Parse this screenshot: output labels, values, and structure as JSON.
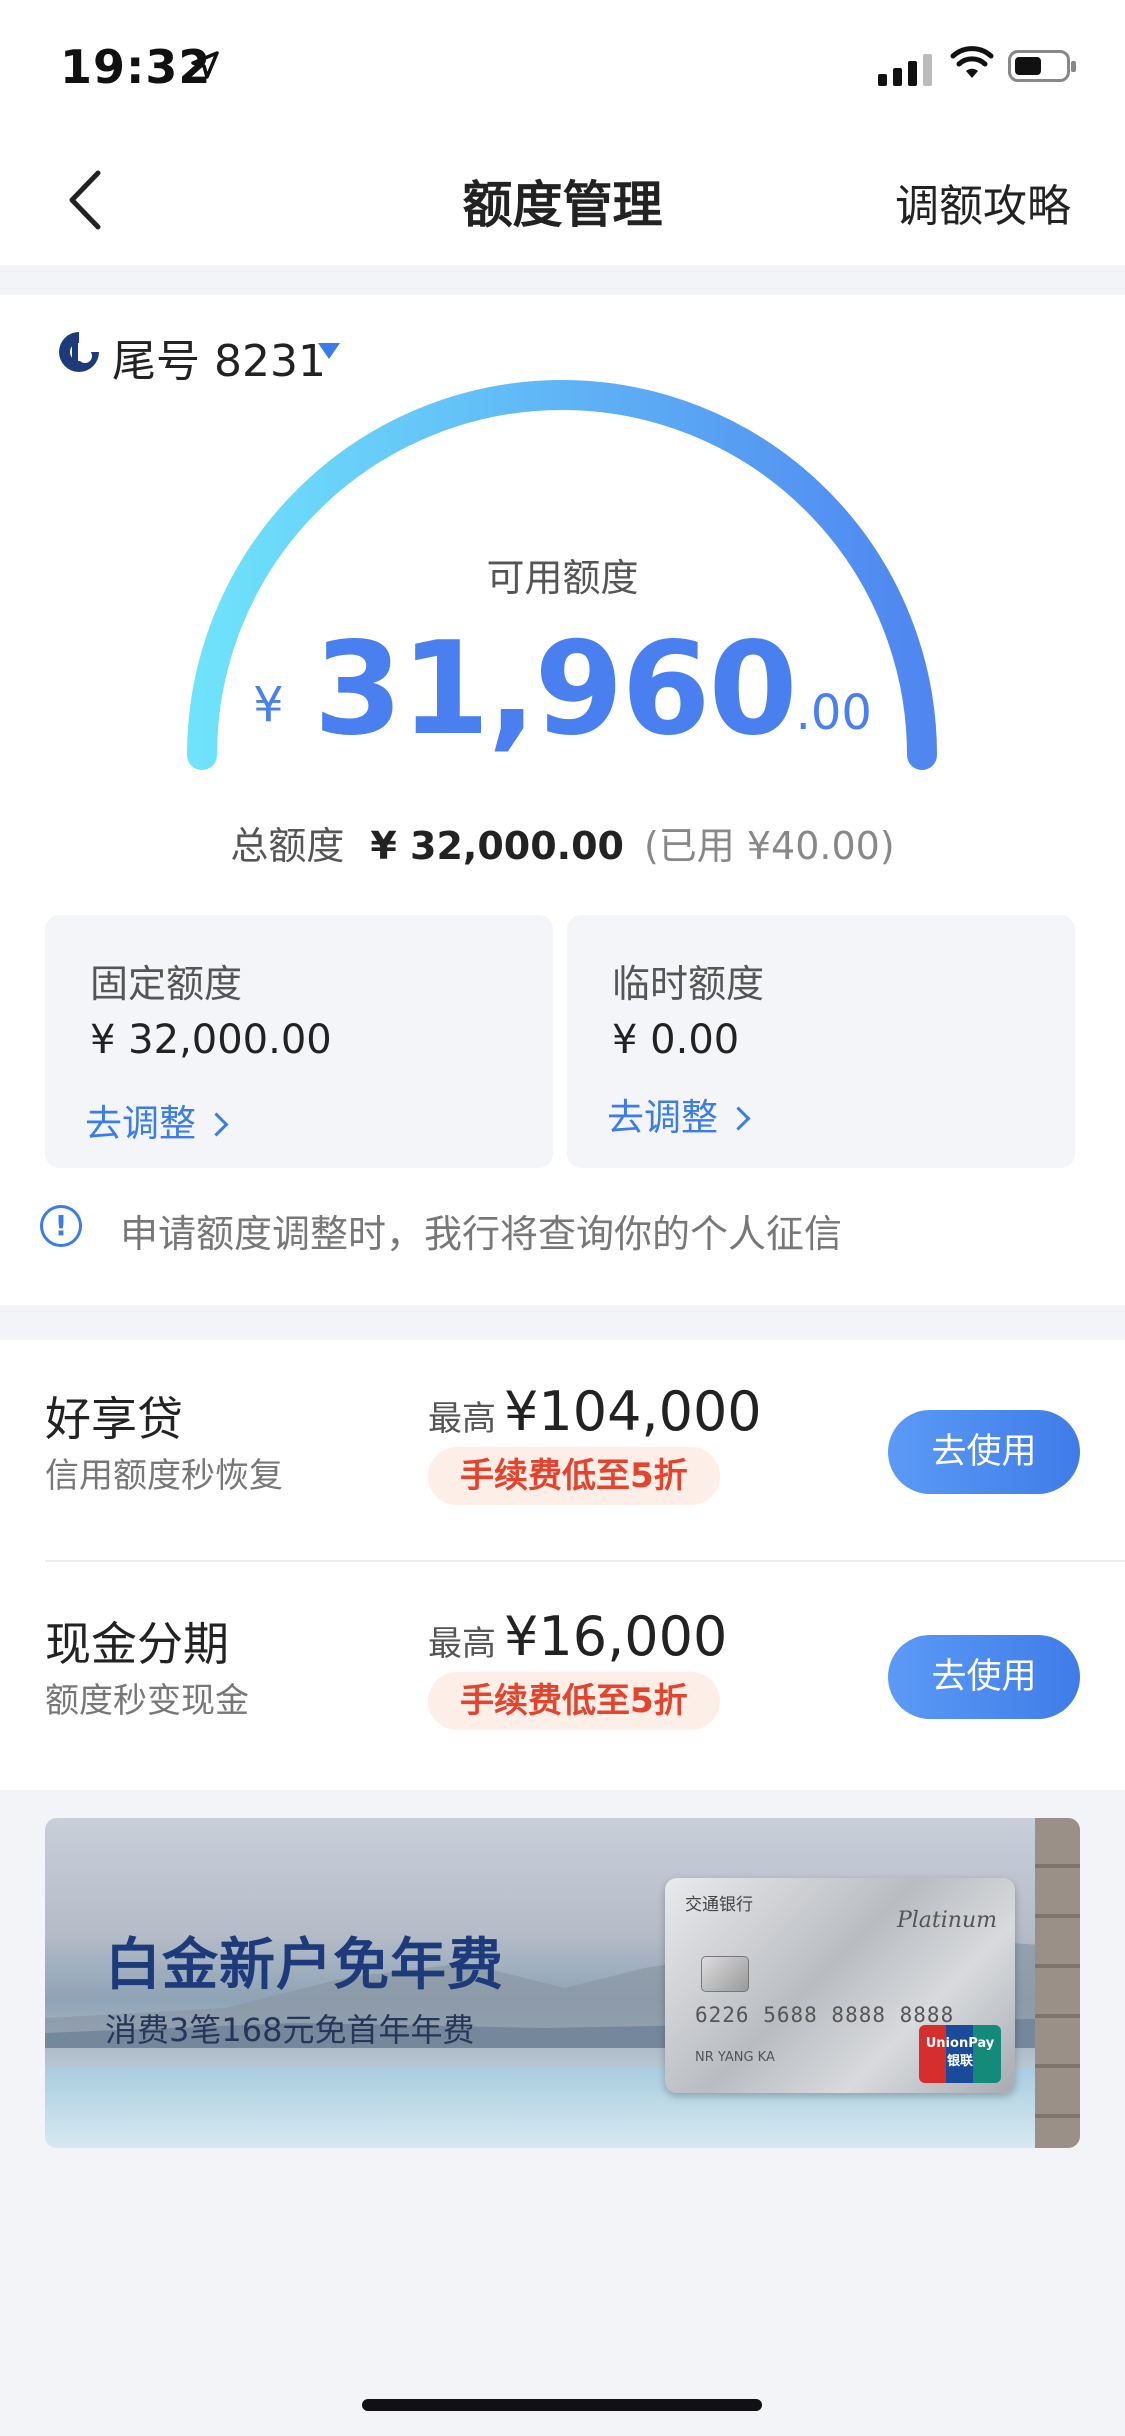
{
  "status_bar": {
    "time": "19:32"
  },
  "nav": {
    "title": "额度管理",
    "right_link": "调额攻略"
  },
  "card_selector": {
    "label": "尾号 8231"
  },
  "gauge": {
    "available_label": "可用额度",
    "currency": "¥",
    "amount_int": "31,960",
    "amount_dec": ".00",
    "fraction_available": 0.99875,
    "colors": {
      "start": "#6fe3fb",
      "end": "#4f86f0"
    }
  },
  "total": {
    "label": "总额度",
    "value": "¥ 32,000.00",
    "used": "(已用 ¥40.00)"
  },
  "limits": [
    {
      "label": "固定额度",
      "value": "¥ 32,000.00",
      "action": "去调整"
    },
    {
      "label": "临时额度",
      "value": "¥ 0.00",
      "action": "去调整"
    }
  ],
  "notice": "申请额度调整时，我行将查询你的个人征信",
  "products": [
    {
      "name": "好享贷",
      "sub": "信用额度秒恢复",
      "max_prefix": "最高",
      "max_value": "¥104,000",
      "tag": "手续费低至5折",
      "button": "去使用"
    },
    {
      "name": "现金分期",
      "sub": "额度秒变现金",
      "max_prefix": "最高",
      "max_value": "¥16,000",
      "tag": "手续费低至5折",
      "button": "去使用"
    }
  ],
  "banner": {
    "title": "白金新户免年费",
    "subtitle": "消费3笔168元免首年年费",
    "card_bank": "交通银行",
    "card_tier": "Platinum",
    "card_number": "6226 5688 8888 8888",
    "card_name": "NR YANG KA",
    "card_network": "UnionPay 银联"
  },
  "colors": {
    "accent": "#3b7bea",
    "tag_red": "#e4432d"
  }
}
